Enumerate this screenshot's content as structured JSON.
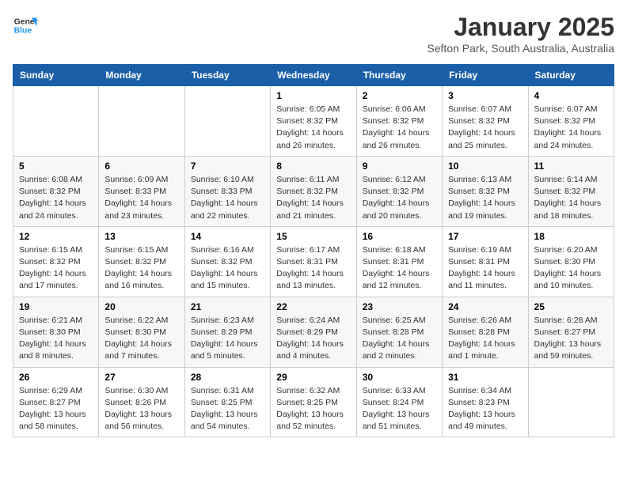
{
  "logo": {
    "line1": "General",
    "line2": "Blue"
  },
  "title": "January 2025",
  "subtitle": "Sefton Park, South Australia, Australia",
  "weekdays": [
    "Sunday",
    "Monday",
    "Tuesday",
    "Wednesday",
    "Thursday",
    "Friday",
    "Saturday"
  ],
  "weeks": [
    [
      {
        "day": "",
        "info": ""
      },
      {
        "day": "",
        "info": ""
      },
      {
        "day": "",
        "info": ""
      },
      {
        "day": "1",
        "info": "Sunrise: 6:05 AM\nSunset: 8:32 PM\nDaylight: 14 hours\nand 26 minutes."
      },
      {
        "day": "2",
        "info": "Sunrise: 6:06 AM\nSunset: 8:32 PM\nDaylight: 14 hours\nand 26 minutes."
      },
      {
        "day": "3",
        "info": "Sunrise: 6:07 AM\nSunset: 8:32 PM\nDaylight: 14 hours\nand 25 minutes."
      },
      {
        "day": "4",
        "info": "Sunrise: 6:07 AM\nSunset: 8:32 PM\nDaylight: 14 hours\nand 24 minutes."
      }
    ],
    [
      {
        "day": "5",
        "info": "Sunrise: 6:08 AM\nSunset: 8:32 PM\nDaylight: 14 hours\nand 24 minutes."
      },
      {
        "day": "6",
        "info": "Sunrise: 6:09 AM\nSunset: 8:33 PM\nDaylight: 14 hours\nand 23 minutes."
      },
      {
        "day": "7",
        "info": "Sunrise: 6:10 AM\nSunset: 8:33 PM\nDaylight: 14 hours\nand 22 minutes."
      },
      {
        "day": "8",
        "info": "Sunrise: 6:11 AM\nSunset: 8:32 PM\nDaylight: 14 hours\nand 21 minutes."
      },
      {
        "day": "9",
        "info": "Sunrise: 6:12 AM\nSunset: 8:32 PM\nDaylight: 14 hours\nand 20 minutes."
      },
      {
        "day": "10",
        "info": "Sunrise: 6:13 AM\nSunset: 8:32 PM\nDaylight: 14 hours\nand 19 minutes."
      },
      {
        "day": "11",
        "info": "Sunrise: 6:14 AM\nSunset: 8:32 PM\nDaylight: 14 hours\nand 18 minutes."
      }
    ],
    [
      {
        "day": "12",
        "info": "Sunrise: 6:15 AM\nSunset: 8:32 PM\nDaylight: 14 hours\nand 17 minutes."
      },
      {
        "day": "13",
        "info": "Sunrise: 6:15 AM\nSunset: 8:32 PM\nDaylight: 14 hours\nand 16 minutes."
      },
      {
        "day": "14",
        "info": "Sunrise: 6:16 AM\nSunset: 8:32 PM\nDaylight: 14 hours\nand 15 minutes."
      },
      {
        "day": "15",
        "info": "Sunrise: 6:17 AM\nSunset: 8:31 PM\nDaylight: 14 hours\nand 13 minutes."
      },
      {
        "day": "16",
        "info": "Sunrise: 6:18 AM\nSunset: 8:31 PM\nDaylight: 14 hours\nand 12 minutes."
      },
      {
        "day": "17",
        "info": "Sunrise: 6:19 AM\nSunset: 8:31 PM\nDaylight: 14 hours\nand 11 minutes."
      },
      {
        "day": "18",
        "info": "Sunrise: 6:20 AM\nSunset: 8:30 PM\nDaylight: 14 hours\nand 10 minutes."
      }
    ],
    [
      {
        "day": "19",
        "info": "Sunrise: 6:21 AM\nSunset: 8:30 PM\nDaylight: 14 hours\nand 8 minutes."
      },
      {
        "day": "20",
        "info": "Sunrise: 6:22 AM\nSunset: 8:30 PM\nDaylight: 14 hours\nand 7 minutes."
      },
      {
        "day": "21",
        "info": "Sunrise: 6:23 AM\nSunset: 8:29 PM\nDaylight: 14 hours\nand 5 minutes."
      },
      {
        "day": "22",
        "info": "Sunrise: 6:24 AM\nSunset: 8:29 PM\nDaylight: 14 hours\nand 4 minutes."
      },
      {
        "day": "23",
        "info": "Sunrise: 6:25 AM\nSunset: 8:28 PM\nDaylight: 14 hours\nand 2 minutes."
      },
      {
        "day": "24",
        "info": "Sunrise: 6:26 AM\nSunset: 8:28 PM\nDaylight: 14 hours\nand 1 minute."
      },
      {
        "day": "25",
        "info": "Sunrise: 6:28 AM\nSunset: 8:27 PM\nDaylight: 13 hours\nand 59 minutes."
      }
    ],
    [
      {
        "day": "26",
        "info": "Sunrise: 6:29 AM\nSunset: 8:27 PM\nDaylight: 13 hours\nand 58 minutes."
      },
      {
        "day": "27",
        "info": "Sunrise: 6:30 AM\nSunset: 8:26 PM\nDaylight: 13 hours\nand 56 minutes."
      },
      {
        "day": "28",
        "info": "Sunrise: 6:31 AM\nSunset: 8:25 PM\nDaylight: 13 hours\nand 54 minutes."
      },
      {
        "day": "29",
        "info": "Sunrise: 6:32 AM\nSunset: 8:25 PM\nDaylight: 13 hours\nand 52 minutes."
      },
      {
        "day": "30",
        "info": "Sunrise: 6:33 AM\nSunset: 8:24 PM\nDaylight: 13 hours\nand 51 minutes."
      },
      {
        "day": "31",
        "info": "Sunrise: 6:34 AM\nSunset: 8:23 PM\nDaylight: 13 hours\nand 49 minutes."
      },
      {
        "day": "",
        "info": ""
      }
    ]
  ]
}
